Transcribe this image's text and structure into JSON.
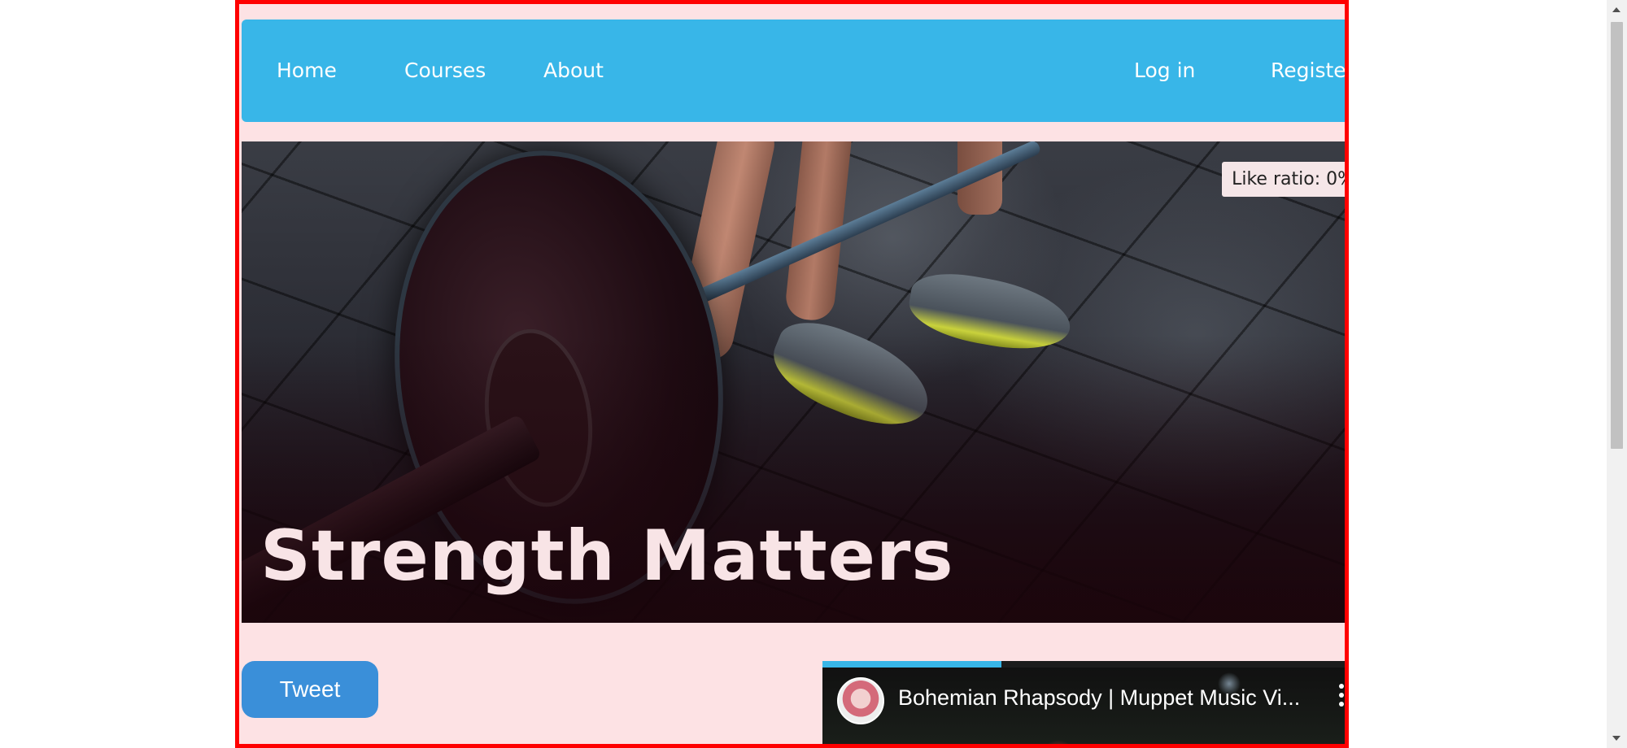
{
  "nav": {
    "home": "Home",
    "courses": "Courses",
    "about": "About",
    "login": "Log in",
    "register": "Register"
  },
  "hero": {
    "like_ratio": "Like ratio: 0%",
    "title": "Strength Matters",
    "image": "barbell-deadlift-photo"
  },
  "tweet": {
    "label": "Tweet"
  },
  "video": {
    "title": "Bohemian Rhapsody | Muppet Music Vi...",
    "avatar": "channel-avatar",
    "menu_icon": "more-vert-icon",
    "progress": 0.33
  },
  "colors": {
    "nav": "#38b6e8",
    "page_bg": "#fde2e4",
    "frame": "#ff0000",
    "tweet": "#3a8fd9"
  }
}
